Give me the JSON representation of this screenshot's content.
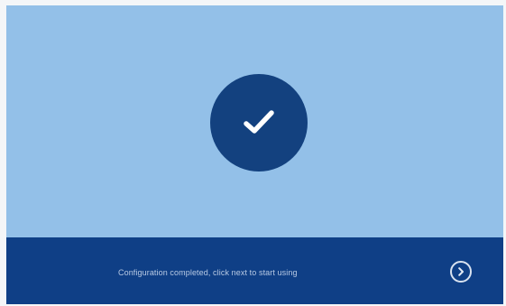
{
  "screen": {
    "background_color": "#93c0e8",
    "success_icon": "checkmark-icon",
    "success_badge_color": "#13417f"
  },
  "footer": {
    "background_color": "#0f3f86",
    "message": "Configuration completed, click next to start using",
    "next_icon": "chevron-right-circle-icon"
  }
}
